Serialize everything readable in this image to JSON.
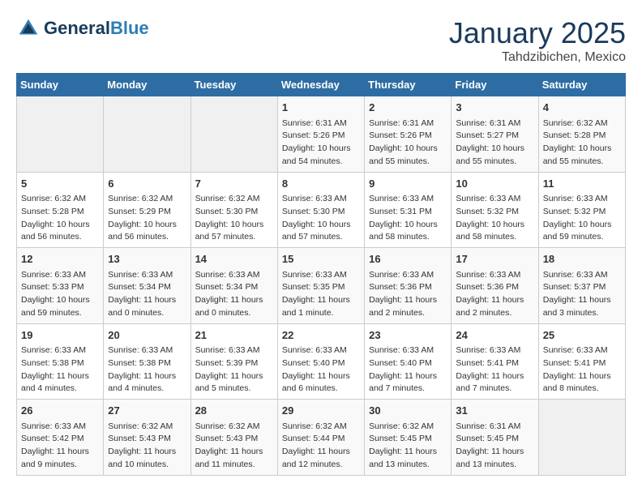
{
  "header": {
    "logo_line1": "General",
    "logo_line2": "Blue",
    "month": "January 2025",
    "location": "Tahdzibichen, Mexico"
  },
  "weekdays": [
    "Sunday",
    "Monday",
    "Tuesday",
    "Wednesday",
    "Thursday",
    "Friday",
    "Saturday"
  ],
  "weeks": [
    [
      {
        "day": "",
        "info": ""
      },
      {
        "day": "",
        "info": ""
      },
      {
        "day": "",
        "info": ""
      },
      {
        "day": "1",
        "info": "Sunrise: 6:31 AM\nSunset: 5:26 PM\nDaylight: 10 hours\nand 54 minutes."
      },
      {
        "day": "2",
        "info": "Sunrise: 6:31 AM\nSunset: 5:26 PM\nDaylight: 10 hours\nand 55 minutes."
      },
      {
        "day": "3",
        "info": "Sunrise: 6:31 AM\nSunset: 5:27 PM\nDaylight: 10 hours\nand 55 minutes."
      },
      {
        "day": "4",
        "info": "Sunrise: 6:32 AM\nSunset: 5:28 PM\nDaylight: 10 hours\nand 55 minutes."
      }
    ],
    [
      {
        "day": "5",
        "info": "Sunrise: 6:32 AM\nSunset: 5:28 PM\nDaylight: 10 hours\nand 56 minutes."
      },
      {
        "day": "6",
        "info": "Sunrise: 6:32 AM\nSunset: 5:29 PM\nDaylight: 10 hours\nand 56 minutes."
      },
      {
        "day": "7",
        "info": "Sunrise: 6:32 AM\nSunset: 5:30 PM\nDaylight: 10 hours\nand 57 minutes."
      },
      {
        "day": "8",
        "info": "Sunrise: 6:33 AM\nSunset: 5:30 PM\nDaylight: 10 hours\nand 57 minutes."
      },
      {
        "day": "9",
        "info": "Sunrise: 6:33 AM\nSunset: 5:31 PM\nDaylight: 10 hours\nand 58 minutes."
      },
      {
        "day": "10",
        "info": "Sunrise: 6:33 AM\nSunset: 5:32 PM\nDaylight: 10 hours\nand 58 minutes."
      },
      {
        "day": "11",
        "info": "Sunrise: 6:33 AM\nSunset: 5:32 PM\nDaylight: 10 hours\nand 59 minutes."
      }
    ],
    [
      {
        "day": "12",
        "info": "Sunrise: 6:33 AM\nSunset: 5:33 PM\nDaylight: 10 hours\nand 59 minutes."
      },
      {
        "day": "13",
        "info": "Sunrise: 6:33 AM\nSunset: 5:34 PM\nDaylight: 11 hours\nand 0 minutes."
      },
      {
        "day": "14",
        "info": "Sunrise: 6:33 AM\nSunset: 5:34 PM\nDaylight: 11 hours\nand 0 minutes."
      },
      {
        "day": "15",
        "info": "Sunrise: 6:33 AM\nSunset: 5:35 PM\nDaylight: 11 hours\nand 1 minute."
      },
      {
        "day": "16",
        "info": "Sunrise: 6:33 AM\nSunset: 5:36 PM\nDaylight: 11 hours\nand 2 minutes."
      },
      {
        "day": "17",
        "info": "Sunrise: 6:33 AM\nSunset: 5:36 PM\nDaylight: 11 hours\nand 2 minutes."
      },
      {
        "day": "18",
        "info": "Sunrise: 6:33 AM\nSunset: 5:37 PM\nDaylight: 11 hours\nand 3 minutes."
      }
    ],
    [
      {
        "day": "19",
        "info": "Sunrise: 6:33 AM\nSunset: 5:38 PM\nDaylight: 11 hours\nand 4 minutes."
      },
      {
        "day": "20",
        "info": "Sunrise: 6:33 AM\nSunset: 5:38 PM\nDaylight: 11 hours\nand 4 minutes."
      },
      {
        "day": "21",
        "info": "Sunrise: 6:33 AM\nSunset: 5:39 PM\nDaylight: 11 hours\nand 5 minutes."
      },
      {
        "day": "22",
        "info": "Sunrise: 6:33 AM\nSunset: 5:40 PM\nDaylight: 11 hours\nand 6 minutes."
      },
      {
        "day": "23",
        "info": "Sunrise: 6:33 AM\nSunset: 5:40 PM\nDaylight: 11 hours\nand 7 minutes."
      },
      {
        "day": "24",
        "info": "Sunrise: 6:33 AM\nSunset: 5:41 PM\nDaylight: 11 hours\nand 7 minutes."
      },
      {
        "day": "25",
        "info": "Sunrise: 6:33 AM\nSunset: 5:41 PM\nDaylight: 11 hours\nand 8 minutes."
      }
    ],
    [
      {
        "day": "26",
        "info": "Sunrise: 6:33 AM\nSunset: 5:42 PM\nDaylight: 11 hours\nand 9 minutes."
      },
      {
        "day": "27",
        "info": "Sunrise: 6:32 AM\nSunset: 5:43 PM\nDaylight: 11 hours\nand 10 minutes."
      },
      {
        "day": "28",
        "info": "Sunrise: 6:32 AM\nSunset: 5:43 PM\nDaylight: 11 hours\nand 11 minutes."
      },
      {
        "day": "29",
        "info": "Sunrise: 6:32 AM\nSunset: 5:44 PM\nDaylight: 11 hours\nand 12 minutes."
      },
      {
        "day": "30",
        "info": "Sunrise: 6:32 AM\nSunset: 5:45 PM\nDaylight: 11 hours\nand 13 minutes."
      },
      {
        "day": "31",
        "info": "Sunrise: 6:31 AM\nSunset: 5:45 PM\nDaylight: 11 hours\nand 13 minutes."
      },
      {
        "day": "",
        "info": ""
      }
    ]
  ]
}
